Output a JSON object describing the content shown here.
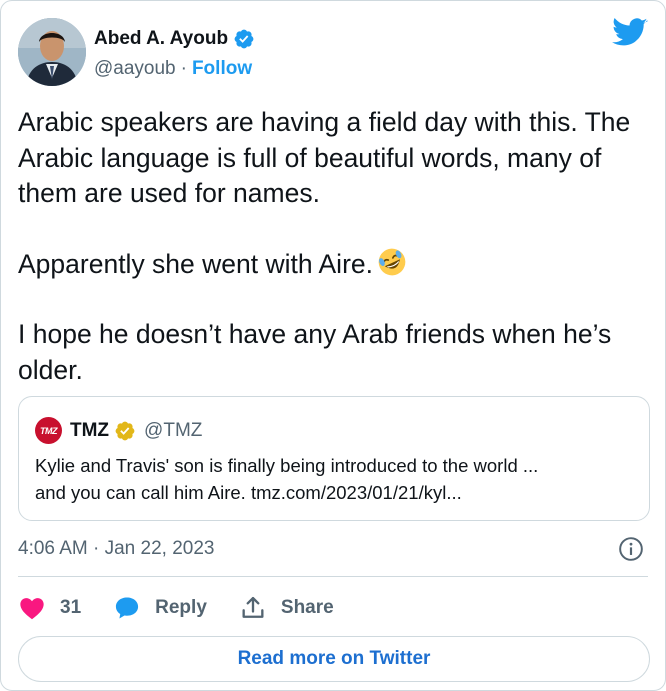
{
  "author": {
    "name": "Abed A. Ayoub",
    "handle": "@aayoub",
    "separator": "·",
    "follow_label": "Follow"
  },
  "tweet": {
    "paragraphs": [
      "Arabic speakers are having a field day with this. The Arabic language is full of beautiful words, many of them are used for names.",
      "Apparently she went with Aire.",
      "I hope he doesn’t have any Arab friends when he’s older."
    ],
    "emoji": "rolling-on-floor-laughing-emoji"
  },
  "quote": {
    "logo_text": "TMZ",
    "name": "TMZ",
    "handle": "@TMZ",
    "text_line1": "Kylie and Travis' son is finally being introduced to the world ...",
    "text_line2": "and you can call him Aire. tmz.com/2023/01/21/kyl..."
  },
  "meta": {
    "timestamp": "4:06 AM · Jan 22, 2023"
  },
  "actions": {
    "likes": "31",
    "reply_label": "Reply",
    "share_label": "Share"
  },
  "footer": {
    "read_more_label": "Read more on Twitter"
  },
  "colors": {
    "brand_blue": "#1d9bf0",
    "like_pink": "#f91880",
    "text": "#0f1419",
    "muted": "#536471",
    "border": "#cfd9de",
    "tmz_red": "#c8102e"
  }
}
